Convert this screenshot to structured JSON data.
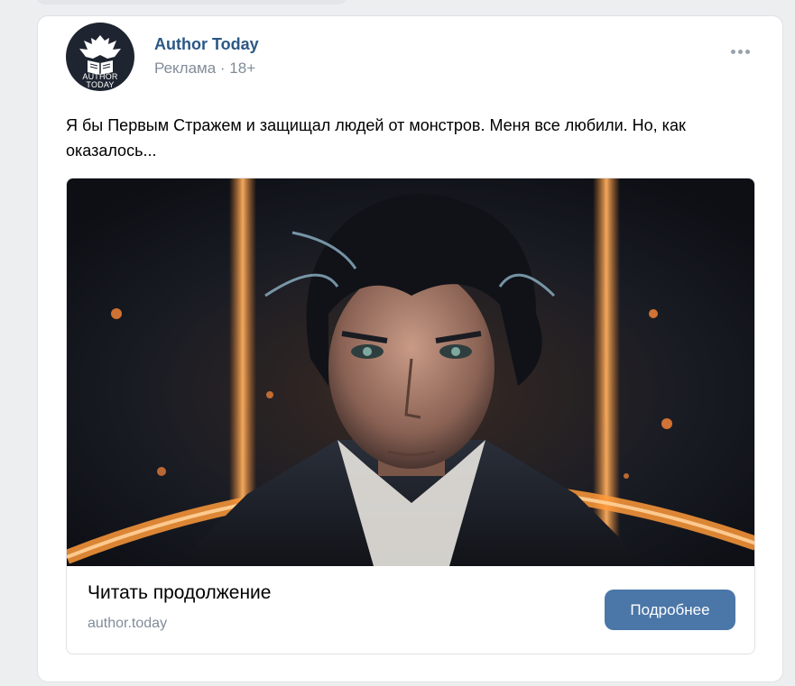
{
  "post": {
    "author_name": "Author Today",
    "avatar_text_line1": "AUTHOR",
    "avatar_text_line2": "TODAY",
    "ad_label": "Реклама · 18+",
    "more_icon": "more-horizontal-icon",
    "text": "Я бы Первым Стражем и защищал людей от монстров. Меня все любили. Но, как оказалось...",
    "attachment": {
      "image": "anime-style dark-haired hero portrait",
      "title": "Читать продолжение",
      "domain": "author.today",
      "button_label": "Подробнее"
    }
  },
  "colors": {
    "page_bg": "#edeef0",
    "author_link": "#2a5885",
    "secondary_text": "#818c99",
    "button_bg": "#4a76a8"
  }
}
